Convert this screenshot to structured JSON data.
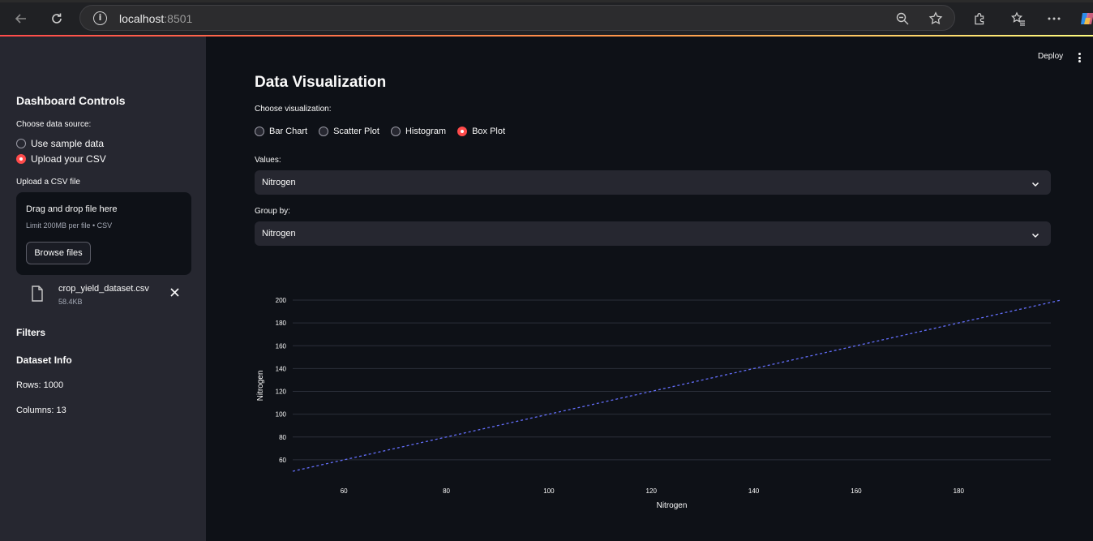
{
  "browser": {
    "url_host": "localhost",
    "url_port": ":8501"
  },
  "app": {
    "deploy_label": "Deploy"
  },
  "sidebar": {
    "title": "Dashboard Controls",
    "source_label": "Choose data source:",
    "source_options": [
      "Use sample data",
      "Upload your CSV"
    ],
    "source_selected": "Upload your CSV",
    "upload_label": "Upload a CSV file",
    "dropzone_title": "Drag and drop file here",
    "dropzone_limit": "Limit 200MB per file • CSV",
    "browse_label": "Browse files",
    "file_name": "crop_yield_dataset.csv",
    "file_size": "58.4KB",
    "filters_heading": "Filters",
    "dataset_heading": "Dataset Info",
    "rows_text": "Rows: 1000",
    "columns_text": "Columns: 13"
  },
  "main": {
    "title": "Data Visualization",
    "viz_label": "Choose visualization:",
    "viz_options": [
      "Bar Chart",
      "Scatter Plot",
      "Histogram",
      "Box Plot"
    ],
    "viz_selected": "Box Plot",
    "values_label": "Values:",
    "values_selected": "Nitrogen",
    "group_label": "Group by:",
    "group_selected": "Nitrogen"
  },
  "colors": {
    "accent": "#ff4b4b",
    "line": "#636efa",
    "background": "#0e1117",
    "sidebar": "#262730"
  },
  "chart_data": {
    "type": "line",
    "line_style": "dashed",
    "x": [
      50,
      200
    ],
    "series": [
      {
        "values": [
          50,
          200
        ]
      }
    ],
    "xlabel": "Nitrogen",
    "ylabel": "Nitrogen",
    "xlim": [
      50,
      198
    ],
    "ylim": [
      50,
      200
    ],
    "xticks": [
      60,
      80,
      100,
      120,
      140,
      160,
      180
    ],
    "yticks": [
      60,
      80,
      100,
      120,
      140,
      160,
      180,
      200
    ],
    "grid": true
  }
}
